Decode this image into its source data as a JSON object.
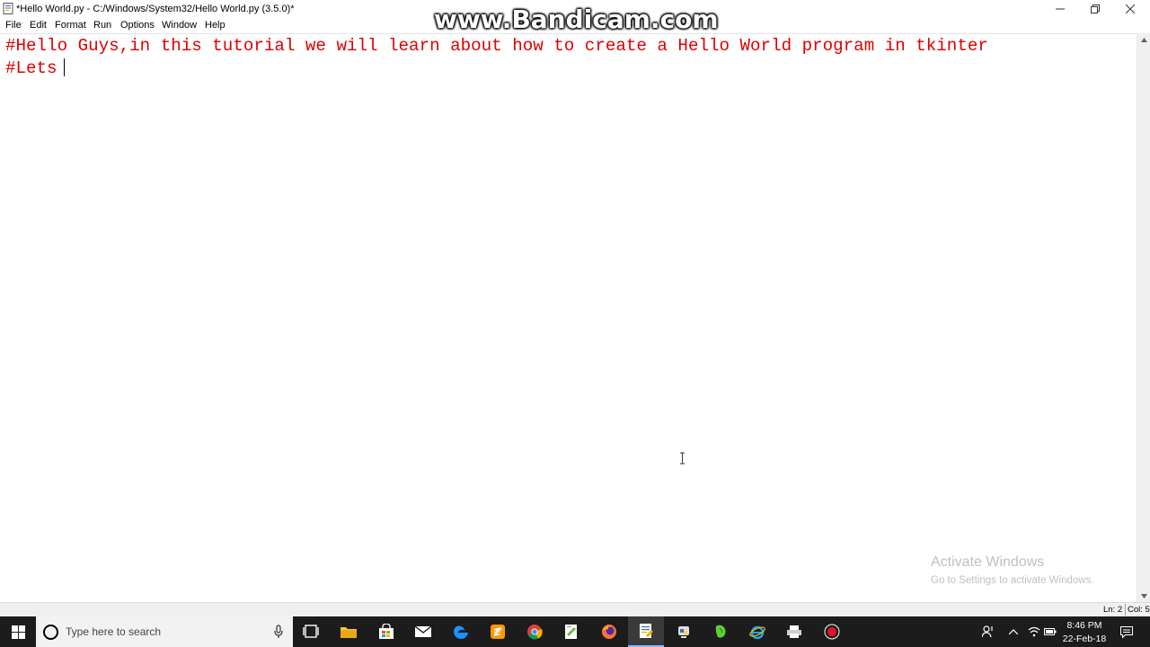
{
  "window": {
    "title": "*Hello World.py - C:/Windows/System32/Hello World.py (3.5.0)*",
    "controls": {
      "minimize": "minimize-icon",
      "restore": "restore-icon",
      "close": "close-icon"
    }
  },
  "watermark": {
    "text": "www.Bandicam.com"
  },
  "menu": {
    "items": [
      "File",
      "Edit",
      "Format",
      "Run",
      "Options",
      "Window",
      "Help"
    ]
  },
  "editor": {
    "lines": [
      "#Hello Guys,in this tutorial we will learn about how to create a Hello World program in tkinter",
      "#Lets"
    ],
    "text_color": "#dd0000"
  },
  "activation": {
    "title": "Activate Windows",
    "subtitle": "Go to Settings to activate Windows."
  },
  "status": {
    "line": "Ln: 2",
    "col": "Col: 5"
  },
  "taskbar": {
    "search_placeholder": "Type here to search",
    "pinned": [
      "task-view-icon",
      "file-explorer-icon",
      "store-icon",
      "mail-icon",
      "edge-icon",
      "sublime-text-icon",
      "chrome-icon",
      "notepad-plus-plus-icon",
      "firefox-icon",
      "idle-editor-icon",
      "python-idle-icon",
      "evernote-icon",
      "internet-explorer-icon",
      "print-icon",
      "bandicam-record-icon"
    ],
    "clock": {
      "time": "8:46 PM",
      "date": "22-Feb-18"
    }
  }
}
